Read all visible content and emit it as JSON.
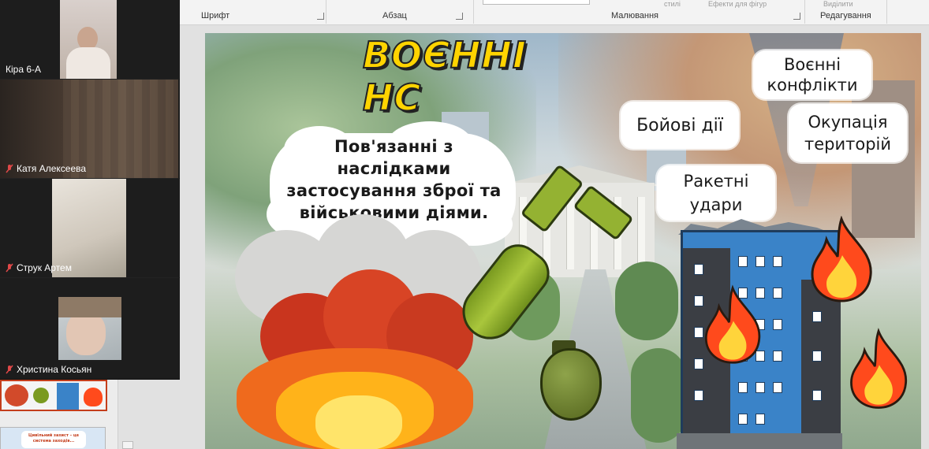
{
  "ribbon": {
    "groups": [
      {
        "label": "Шрифт"
      },
      {
        "label": "Абзац"
      },
      {
        "label": "Малювання"
      },
      {
        "label": "Редагування"
      }
    ],
    "ghost_texts": [
      "стилі",
      "Ефекти для фігур",
      "Виділити"
    ]
  },
  "participants": [
    {
      "name": "Кіра 6-А",
      "muted": false
    },
    {
      "name": "Катя Алексеева",
      "muted": true
    },
    {
      "name": "Струк Артем",
      "muted": true
    },
    {
      "name": "Христина Косьян",
      "muted": true
    }
  ],
  "thumbnail_text": "Цивільний захист – це система заходів...",
  "slide": {
    "title": "ВОЄННІ НС",
    "description": "Пов'язанні з наслідками застосування зброї та військовими діями.",
    "bubbles": {
      "conflicts": "Воєнні конфлікти",
      "combat": "Бойові дії",
      "occupation": "Окупація територій",
      "missiles": "Ракетні удари"
    }
  },
  "colors": {
    "title_fill": "#ffd400",
    "title_outline": "#222222",
    "building_blue": "#3a83c8",
    "flame_outer": "#ff4a1c",
    "flame_inner": "#ffd43b",
    "selected_thumb_border": "#c43e1c",
    "call_panel_bg": "#232323"
  }
}
